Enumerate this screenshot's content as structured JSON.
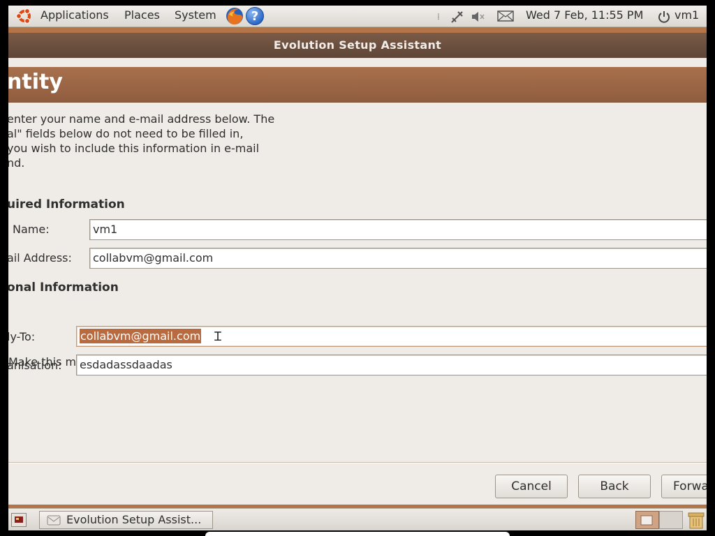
{
  "top_panel": {
    "menus": [
      "Applications",
      "Places",
      "System"
    ],
    "datetime": "Wed  7 Feb, 11:55 PM",
    "user": "vm1"
  },
  "window": {
    "title": "Evolution Setup Assistant",
    "page_title": "ntity",
    "intro_lines": [
      "enter your name and e-mail address below. The",
      "al\" fields below do not need to be filled in,",
      "you wish to include this information in e-mail",
      "nd."
    ],
    "required_heading": "uired Information",
    "name_label": "Name:",
    "name_value": "vm1",
    "email_label": "ail Address:",
    "email_value": "collabvm@gmail.com",
    "optional_heading": "onal Information",
    "default_checkbox_label": "Make this my default account",
    "reply_to_label": "ly-To:",
    "reply_to_value": "collabvm@gmail.com",
    "organisation_label": "anisation:",
    "organisation_value": "esdadassdaadas",
    "buttons": {
      "cancel": "Cancel",
      "back": "Back",
      "forward": "Forwa"
    }
  },
  "bottom_panel": {
    "task": "Evolution Setup Assist..."
  },
  "colors": {
    "accent": "#b37447",
    "title_bar": "#5d4537",
    "header": "#9a6444",
    "selection": "#b96a3f"
  }
}
